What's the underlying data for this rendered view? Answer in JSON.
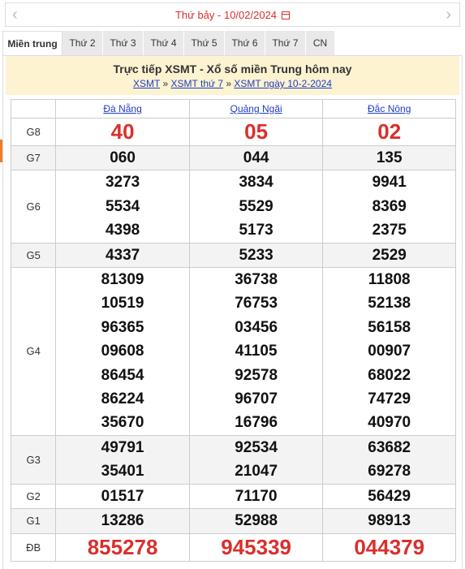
{
  "date_bar": {
    "prev_icon": "chevron-left-icon",
    "next_icon": "chevron-right-icon",
    "label": "Thứ bảy -  10/02/2024",
    "calendar_icon": "calendar-icon"
  },
  "tabs": [
    "Miền trung",
    "Thứ 2",
    "Thứ 3",
    "Thứ 4",
    "Thứ 5",
    "Thứ 6",
    "Thứ 7",
    "CN"
  ],
  "header": {
    "title": "Trực tiếp XSMT - Xổ số miền Trung hôm nay",
    "crumbs": [
      "XSMT",
      "XSMT thứ 7",
      "XSMT ngày 10-2-2024"
    ],
    "sep": "»"
  },
  "provinces": [
    "Đà Nẵng",
    "Quảng Ngãi",
    "Đắc Nông"
  ],
  "prizes": [
    {
      "label": "G8",
      "rows": [
        [
          "40",
          "05",
          "02"
        ]
      ]
    },
    {
      "label": "G7",
      "rows": [
        [
          "060",
          "044",
          "135"
        ]
      ]
    },
    {
      "label": "G6",
      "rows": [
        [
          "3273",
          "3834",
          "9941"
        ],
        [
          "5534",
          "5529",
          "8369"
        ],
        [
          "4398",
          "5173",
          "2375"
        ]
      ]
    },
    {
      "label": "G5",
      "rows": [
        [
          "4337",
          "5233",
          "2529"
        ]
      ]
    },
    {
      "label": "G4",
      "rows": [
        [
          "81309",
          "36738",
          "11808"
        ],
        [
          "10519",
          "76753",
          "52138"
        ],
        [
          "96365",
          "03456",
          "56158"
        ],
        [
          "09608",
          "41105",
          "00907"
        ],
        [
          "86454",
          "92578",
          "68022"
        ],
        [
          "86224",
          "96707",
          "74729"
        ],
        [
          "35670",
          "16796",
          "40970"
        ]
      ]
    },
    {
      "label": "G3",
      "rows": [
        [
          "49791",
          "92534",
          "63682"
        ],
        [
          "35401",
          "21047",
          "69278"
        ]
      ]
    },
    {
      "label": "G2",
      "rows": [
        [
          "01517",
          "71170",
          "56429"
        ]
      ]
    },
    {
      "label": "G1",
      "rows": [
        [
          "13286",
          "52988",
          "98913"
        ]
      ]
    },
    {
      "label": "ĐB",
      "rows": [
        [
          "855278",
          "945339",
          "044379"
        ]
      ]
    }
  ]
}
